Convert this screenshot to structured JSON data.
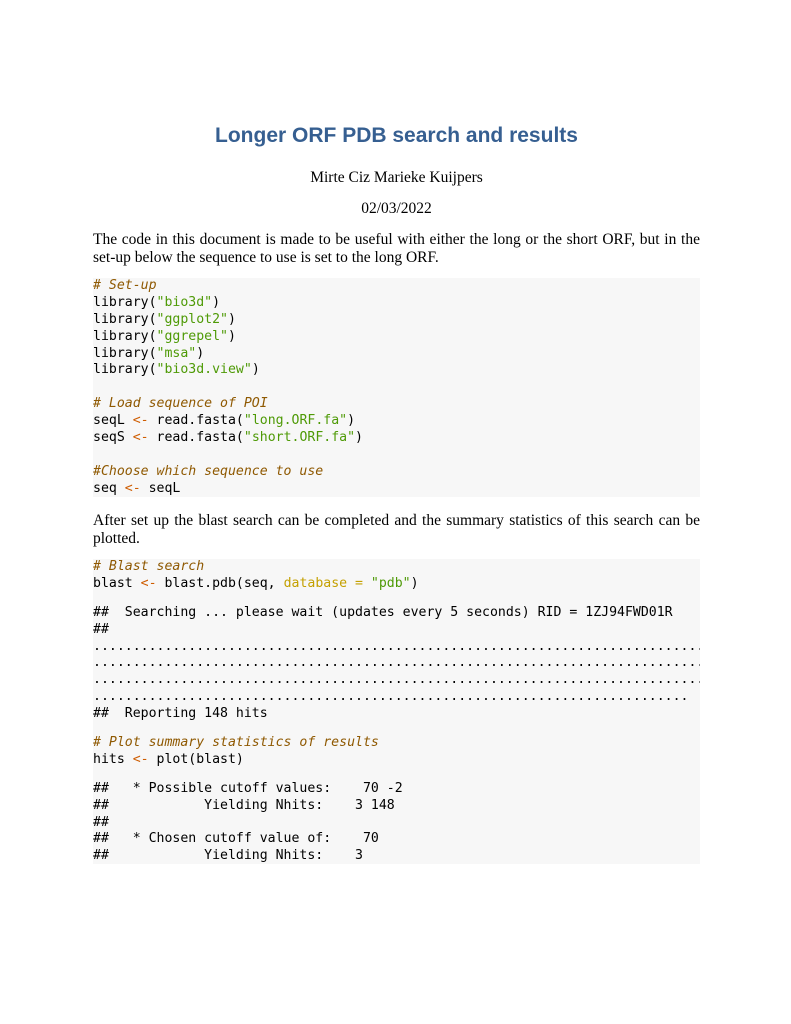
{
  "doc": {
    "title": "Longer ORF PDB search and results",
    "author": "Mirte Ciz Marieke Kuijpers",
    "date": "02/03/2022",
    "para1": "The code in this document is made to be useful with either the long or the short ORF, but in the set-up below the sequence to use is set to the long ORF.",
    "para2": "After set up the blast search can be completed and the summary statistics of this search can be plotted."
  },
  "code1": {
    "c_setup": "# Set-up",
    "lib1_fn": "library(",
    "lib1_str": "\"bio3d\"",
    "lib2_str": "\"ggplot2\"",
    "lib3_str": "\"ggrepel\"",
    "lib4_str": "\"msa\"",
    "lib5_str": "\"bio3d.view\"",
    "close": ")",
    "c_load": "# Load sequence of POI",
    "seqL_var": "seqL ",
    "arrow": "<-",
    "readfasta": " read.fasta(",
    "longfa": "\"long.ORF.fa\"",
    "seqS_var": "seqS ",
    "shortfa": "\"short.ORF.fa\"",
    "c_choose": "#Choose which sequence to use",
    "seq_var": "seq ",
    "seqL_val": " seqL"
  },
  "code2": {
    "c_blast": "# Blast search",
    "blast_var": "blast ",
    "arrow": "<-",
    "blastpdb": " blast.pdb(seq, ",
    "db_arg": "database =",
    "db_str": " \"pdb\"",
    "close": ")",
    "out1": "##  Searching ... please wait (updates every 5 seconds) RID = 1ZJ94FWD01R",
    "out2": "##",
    "dots1": ".............................................................................",
    "dots2": ".............................................................................",
    "dots3": ".............................................................................",
    "dots4": "...........................................................................",
    "out3": "##  Reporting 148 hits",
    "c_plot": "# Plot summary statistics of results",
    "hits_var": "hits ",
    "plot_call": " plot(blast)",
    "res1": "##   * Possible cutoff values:    70 -2",
    "res2": "##            Yielding Nhits:    3 148",
    "res3": "##",
    "res4": "##   * Chosen cutoff value of:    70",
    "res5": "##            Yielding Nhits:    3"
  }
}
